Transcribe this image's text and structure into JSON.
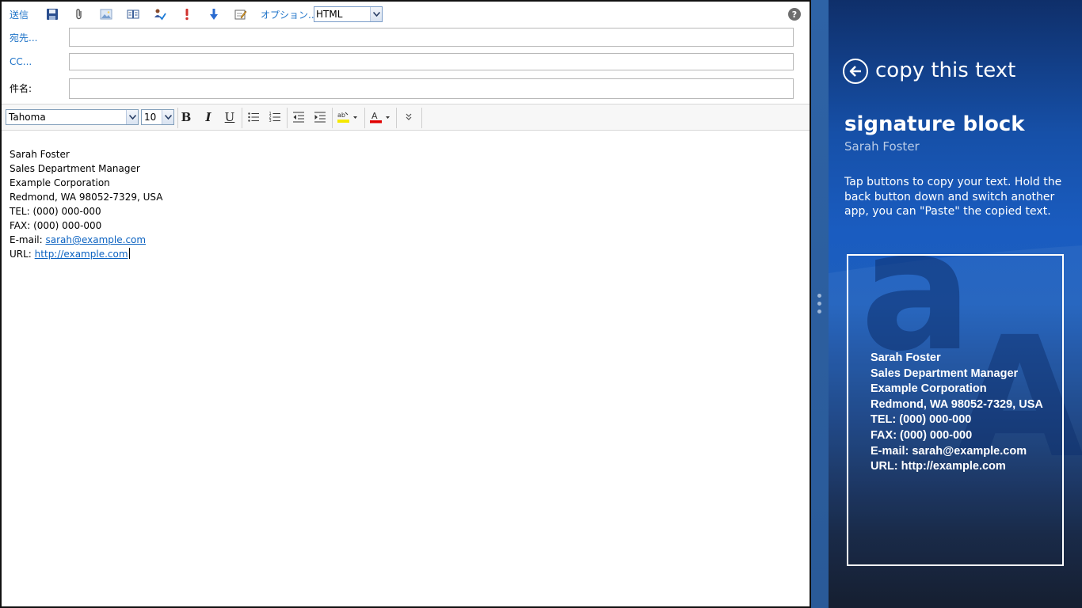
{
  "mail": {
    "toolbar": {
      "send_label": "送信",
      "options_label": "オプション...",
      "format_value": "HTML",
      "icons": [
        "save-icon",
        "attach-icon",
        "insert-image-icon",
        "address-book-icon",
        "spell-check-icon",
        "high-importance-icon",
        "low-importance-icon",
        "signature-icon"
      ],
      "help_label": "?"
    },
    "fields": {
      "to_label": "宛先...",
      "cc_label": "CC...",
      "subject_label": "件名:",
      "to_value": "",
      "cc_value": "",
      "subject_value": ""
    },
    "format_bar": {
      "font_value": "Tahoma",
      "size_value": "10",
      "bold_label": "B",
      "italic_label": "I",
      "underline_label": "U"
    },
    "body": {
      "lines": [
        "Sarah Foster",
        "Sales Department Manager",
        "Example Corporation",
        "Redmond, WA 98052-7329, USA",
        "TEL: (000) 000-000",
        "FAX: (000) 000-000"
      ],
      "email_prefix": "E-mail: ",
      "email_link": "sarah@example.com",
      "url_prefix": "URL: ",
      "url_link": "http://example.com"
    }
  },
  "app": {
    "title": "copy this text",
    "section_title": "signature block",
    "section_subtitle": "Sarah Foster",
    "instructions": "Tap buttons to copy your text. Hold the back button down and switch another app, you can \"Paste\" the copied text.",
    "card_lines": [
      "Sarah Foster",
      "Sales Department Manager",
      "Example Corporation",
      "Redmond, WA 98052-7329, USA",
      "TEL: (000) 000-000",
      "FAX: (000) 000-000",
      "E-mail: sarah@example.com",
      "URL: http://example.com"
    ],
    "colors": {
      "panel_top": "#0f2f6a",
      "panel_mid": "#1d5fbd",
      "panel_bottom": "#0a1426",
      "link": "#1e73c8"
    }
  }
}
